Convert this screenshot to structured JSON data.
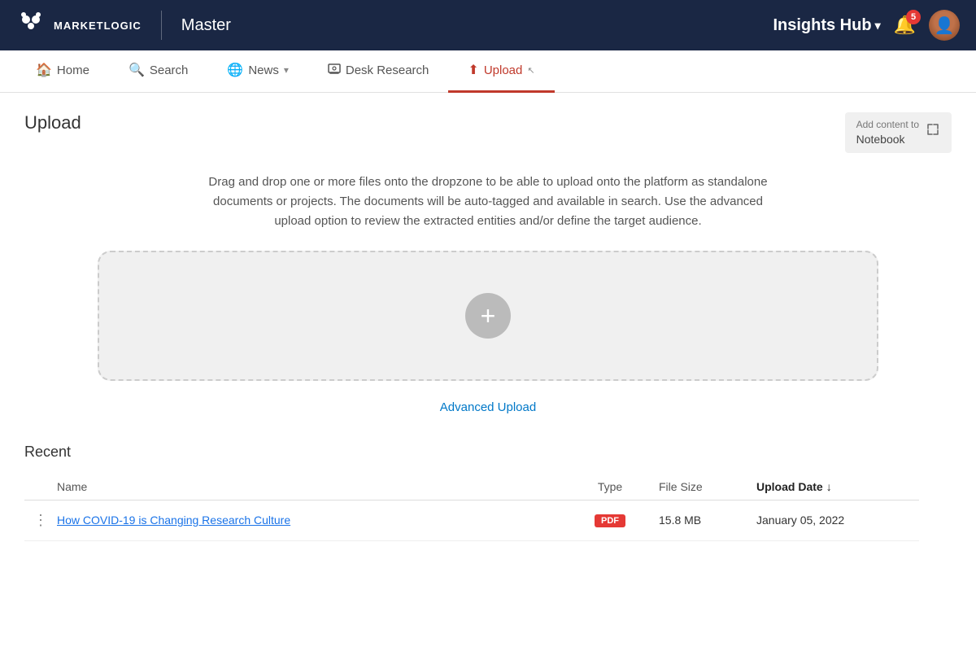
{
  "app": {
    "logo_text": "MARKETLOGIC",
    "nav_title": "Master"
  },
  "top_nav": {
    "insights_hub_label": "Insights Hub",
    "caret": "▾",
    "notification_count": "5"
  },
  "secondary_nav": {
    "items": [
      {
        "id": "home",
        "label": "Home",
        "icon": "🏠",
        "active": false
      },
      {
        "id": "search",
        "label": "Search",
        "icon": "🔍",
        "active": false
      },
      {
        "id": "news",
        "label": "News",
        "icon": "🌐",
        "active": false,
        "has_caret": true
      },
      {
        "id": "desk-research",
        "label": "Desk Research",
        "icon": "🖥",
        "active": false
      },
      {
        "id": "upload",
        "label": "Upload",
        "icon": "⬆",
        "active": true
      }
    ]
  },
  "page": {
    "title": "Upload",
    "notebook_btn": {
      "line1": "Add content to",
      "line2": "Notebook"
    },
    "description": "Drag and drop one or more files onto the dropzone to be able to upload onto the platform as standalone documents or projects. The documents will be auto-tagged and available in search. Use the advanced upload option to review the extracted entities and/or define the target audience.",
    "advanced_upload_label": "Advanced Upload"
  },
  "recent": {
    "title": "Recent",
    "columns": {
      "name": "Name",
      "type": "Type",
      "file_size": "File Size",
      "upload_date": "Upload Date"
    },
    "rows": [
      {
        "name": "How COVID-19 is Changing Research Culture",
        "type": "PDF",
        "file_size": "15.8 MB",
        "upload_date": "January 05, 2022"
      }
    ]
  }
}
